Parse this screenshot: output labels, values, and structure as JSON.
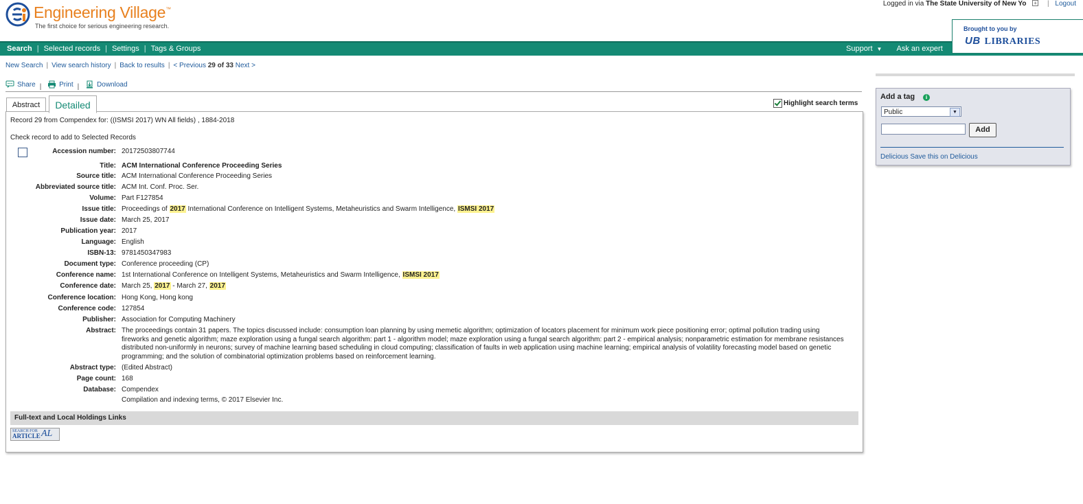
{
  "header": {
    "logo_title": "Engineering Village",
    "logo_tm": "™",
    "tagline": "The first choice for serious engineering research.",
    "logged_in_prefix": "Logged in via",
    "institution": "The State University of New Yo",
    "logout": "Logout",
    "brought_by": "Brought to you by",
    "library_mark": "UB",
    "library_name": "LIBRARIES"
  },
  "nav": {
    "left": [
      "Search",
      "Selected records",
      "Settings",
      "Tags & Groups"
    ],
    "support": "Support",
    "ask": "Ask an expert"
  },
  "crumbs": {
    "new_search": "New Search",
    "history": "View search history",
    "back": "Back to results",
    "previous": "< Previous",
    "position": "29 of 33",
    "next": "Next >"
  },
  "actions": {
    "share": "Share",
    "print": "Print",
    "download": "Download"
  },
  "tabs": {
    "abstract": "Abstract",
    "detailed": "Detailed",
    "highlight": "Highlight search terms"
  },
  "record": {
    "from": "Record 29 from Compendex for: ((ISMSI 2017) WN All fields) , 1884-2018",
    "check_note": "Check record to add to Selected Records",
    "accession_label": "Accession number:",
    "accession": "20172503807744",
    "title_label": "Title:",
    "title": "ACM International Conference Proceeding Series",
    "source_label": "Source title:",
    "source": "ACM International Conference Proceeding Series",
    "abbr_label": "Abbreviated source title:",
    "abbr": "ACM Int. Conf. Proc. Ser.",
    "volume_label": "Volume:",
    "volume": "Part F127854",
    "issue_title_label": "Issue title:",
    "issue_title_a": "Proceedings of ",
    "issue_title_h1": "2017",
    "issue_title_b": " International Conference on Intelligent Systems, Metaheuristics and Swarm Intelligence, ",
    "issue_title_h2": "ISMSI 2017",
    "issue_date_label": "Issue date:",
    "issue_date": "March 25, 2017",
    "pub_year_label": "Publication year:",
    "pub_year": "2017",
    "language_label": "Language:",
    "language": "English",
    "isbn_label": "ISBN-13:",
    "isbn": "9781450347983",
    "doctype_label": "Document type:",
    "doctype": "Conference proceeding (CP)",
    "conf_name_label": "Conference name:",
    "conf_name_a": "1st International Conference on Intelligent Systems, Metaheuristics and Swarm Intelligence, ",
    "conf_name_h": "ISMSI 2017",
    "conf_date_label": "Conference date:",
    "conf_date_a": "March 25, ",
    "conf_date_h1": "2017",
    "conf_date_b": " - March 27, ",
    "conf_date_h2": "2017",
    "conf_loc_label": "Conference location:",
    "conf_loc": "Hong Kong, Hong kong",
    "conf_code_label": "Conference code:",
    "conf_code": "127854",
    "publisher_label": "Publisher:",
    "publisher": "Association for Computing Machinery",
    "abstract_label": "Abstract:",
    "abstract": "The proceedings contain 31 papers. The topics discussed include: consumption loan planning by using memetic algorithm; optimization of locators placement for minimum work piece positioning error; optimal pollution trading using fireworks and genetic algorithm; maze exploration using a fungal search algorithm: part 1 - algorithm model; maze exploration using a fungal search algorithm: part 2 - empirical analysis; nonparametric estimation for membrane resistances distributed non-uniformly in neurons; survey of machine learning based scheduling in cloud computing; classification of faults in web application using machine learning; empirical analysis of volatility forecasting model based on genetic programming; and the solution of combinatorial optimization problems based on reinforcement learning.",
    "abstract_type_label": "Abstract type:",
    "abstract_type": "(Edited Abstract)",
    "page_count_label": "Page count:",
    "page_count": "168",
    "database_label": "Database:",
    "database": "Compendex",
    "copyright": "Compilation and indexing terms, © 2017 Elsevier Inc."
  },
  "fulltext": {
    "heading": "Full-text and Local Holdings Links",
    "btn_line1": "SEARCH FOR",
    "btn_line2": "ARTICLE",
    "btn_mark": "AL"
  },
  "tagbox": {
    "title": "Add a tag",
    "info": "i",
    "visibility": "Public",
    "add": "Add",
    "delicious": "Delicious",
    "save_delicious": "Save this on Delicious"
  },
  "colors": {
    "brand_green": "#148a74",
    "logo_orange": "#e8801e",
    "link_blue": "#1e5a9b",
    "highlight": "#fdf28f"
  }
}
